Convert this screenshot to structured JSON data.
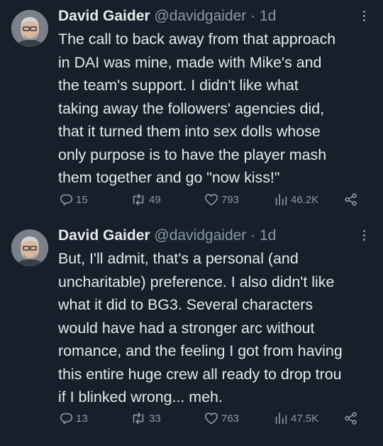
{
  "tweets": [
    {
      "name": "David Gaider",
      "handle": "@davidgaider",
      "separator": "·",
      "time": "1d",
      "lines": [
        "The call to back away from that approach",
        "in DAI was mine, made with Mike's and",
        "the team's support. I didn't like what",
        "taking away the followers' agencies did,",
        "that it turned them into sex dolls whose",
        "only purpose is to have the player mash",
        "them together and go \"now kiss!\""
      ],
      "replies": "15",
      "retweets": "49",
      "likes": "793",
      "views": "46.2K"
    },
    {
      "name": "David Gaider",
      "handle": "@davidgaider",
      "separator": "·",
      "time": "1d",
      "lines": [
        "But, I'll admit, that's a personal (and",
        "uncharitable) preference. I also didn't like",
        "what it did to BG3. Several characters",
        "would have had a stronger arc without",
        "romance, and the feeling I got from having",
        "this entire huge crew all ready to drop trou",
        "if I blinked wrong... meh."
      ],
      "replies": "13",
      "retweets": "33",
      "likes": "763",
      "views": "47.5K"
    }
  ],
  "colors": {
    "background": "#15202b",
    "text": "#e7e9ea",
    "muted": "#8b98a5"
  },
  "icons": [
    "avatar-photo",
    "more-dots-icon",
    "reply-icon",
    "retweet-icon",
    "like-heart-icon",
    "views-bar-icon",
    "share-icon"
  ]
}
